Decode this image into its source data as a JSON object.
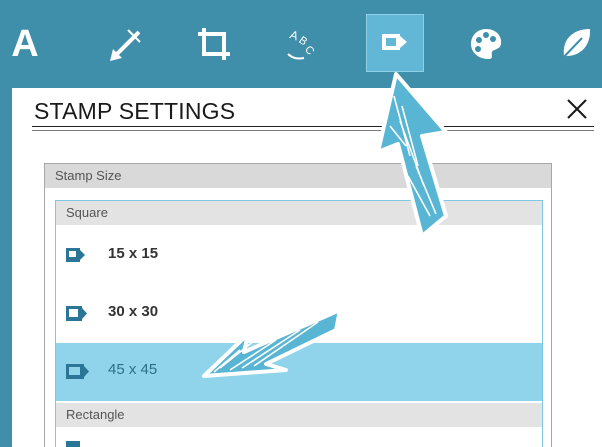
{
  "toolbar": {
    "tools": [
      {
        "name": "text",
        "label": "A"
      },
      {
        "name": "line"
      },
      {
        "name": "crop"
      },
      {
        "name": "text-art"
      },
      {
        "name": "stamp",
        "active": true
      },
      {
        "name": "color-palette"
      },
      {
        "name": "nature"
      }
    ]
  },
  "panel": {
    "title": "STAMP SETTINGS",
    "stamp_size": {
      "header": "Stamp Size",
      "groups": [
        {
          "label": "Square",
          "items": [
            {
              "label": "15 x 15",
              "selected": false
            },
            {
              "label": "30 x 30",
              "selected": false
            },
            {
              "label": "45 x 45",
              "selected": true
            }
          ]
        },
        {
          "label": "Rectangle",
          "items": []
        }
      ]
    }
  },
  "colors": {
    "toolbar_bg": "#3f8fab",
    "active_tool_bg": "#62b7d6",
    "selected_row_bg": "#8fd4ea",
    "stamp_icon": "#2b7696",
    "arrow": "#58b5d3"
  }
}
